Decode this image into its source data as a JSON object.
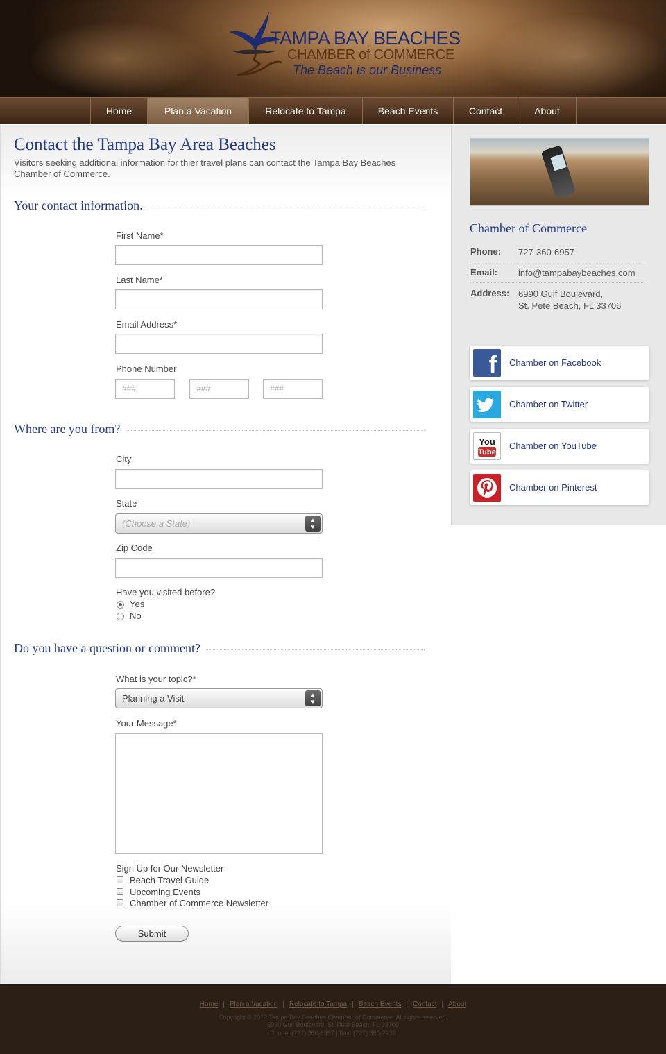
{
  "header": {
    "logo_line1": "TAMPA BAY BEACHES",
    "logo_line2": "CHAMBER of COMMERCE",
    "tagline": "The Beach is our Business"
  },
  "nav": {
    "items": [
      "Home",
      "Plan a Vacation",
      "Relocate to Tampa",
      "Beach Events",
      "Contact",
      "About"
    ],
    "active": "Plan a Vacation"
  },
  "main": {
    "title": "Contact the Tampa Bay Area Beaches",
    "intro": "Visitors seeking additional information for thier travel plans can contact the Tampa Bay Beaches Chamber of Commerce.",
    "section1": {
      "title": "Your contact information.",
      "first_name_label": "First Name*",
      "last_name_label": "Last Name*",
      "email_label": "Email Address*",
      "phone_label": "Phone Number",
      "phone_placeholders": [
        "###",
        "###",
        "###"
      ]
    },
    "section2": {
      "title": "Where are you from?",
      "city_label": "City",
      "state_label": "State",
      "state_value": "(Choose a State)",
      "zip_label": "Zip Code",
      "visited_label": "Have you visited before?",
      "visited_options": [
        "Yes",
        "No"
      ],
      "visited_selected": "Yes"
    },
    "section3": {
      "title": "Do you have a question or comment?",
      "topic_label": "What is your topic?*",
      "topic_value": "Planning a Visit",
      "message_label": "Your Message*",
      "newsletter_label": "Sign Up for Our Newsletter",
      "newsletter_options": [
        "Beach Travel Guide",
        "Upcoming Events",
        "Chamber of Commerce Newsletter"
      ],
      "submit_label": "Submit"
    }
  },
  "sidebar": {
    "title": "Chamber of Commerce",
    "phone_label": "Phone:",
    "phone": "727-360-6957",
    "email_label": "Email:",
    "email": "info@tampabaybeaches.com",
    "address_label": "Address:",
    "address_line1": "6990 Gulf Boulevard,",
    "address_line2": "St. Pete Beach, FL 33706",
    "social": [
      {
        "label": "Chamber on Facebook",
        "icon": "facebook-icon",
        "color": "#3b5998"
      },
      {
        "label": "Chamber on Twitter",
        "icon": "twitter-icon",
        "color": "#2aa9e0"
      },
      {
        "label": "Chamber on YouTube",
        "icon": "youtube-icon",
        "color": "#c4302b"
      },
      {
        "label": "Chamber on Pinterest",
        "icon": "pinterest-icon",
        "color": "#cb2027"
      }
    ]
  },
  "footer": {
    "links": [
      "Home",
      "Plan a Vacation",
      "Relocate to Tampa",
      "Beach Events",
      "Contact",
      "About"
    ],
    "copyright": "Copyright © 2012 Tampa Bay Beaches Chamber of Commerce. All rights reserved.",
    "address": "6990 Gulf Boulevard, St. Pete Beach, FL 33706",
    "phone": "Phone: (727) 360-6957 | Fax: (727) 360-2233"
  },
  "colors": {
    "heading_blue": "#233a8e",
    "nav_brown": "#4f341f",
    "footer_bg": "#2c2016"
  }
}
